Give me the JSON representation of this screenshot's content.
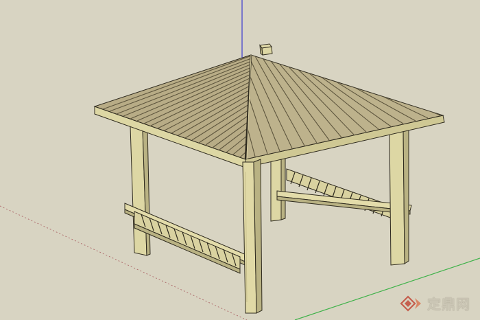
{
  "viewport": {
    "description_label": "",
    "watermark_text": "定鼎网",
    "watermark_icon": "diamond-logo-icon"
  },
  "colors": {
    "background": "#d8d4c2",
    "axis_blue": "#3a3ad0",
    "axis_green": "#3fb24a",
    "axis_red_dotted": "#b07070",
    "wood": "#ddd7a4",
    "wood_shadow": "#b9b283",
    "roof": "#b8ac86",
    "roof_line": "#5e563e",
    "outline": "#2e2a1e"
  }
}
